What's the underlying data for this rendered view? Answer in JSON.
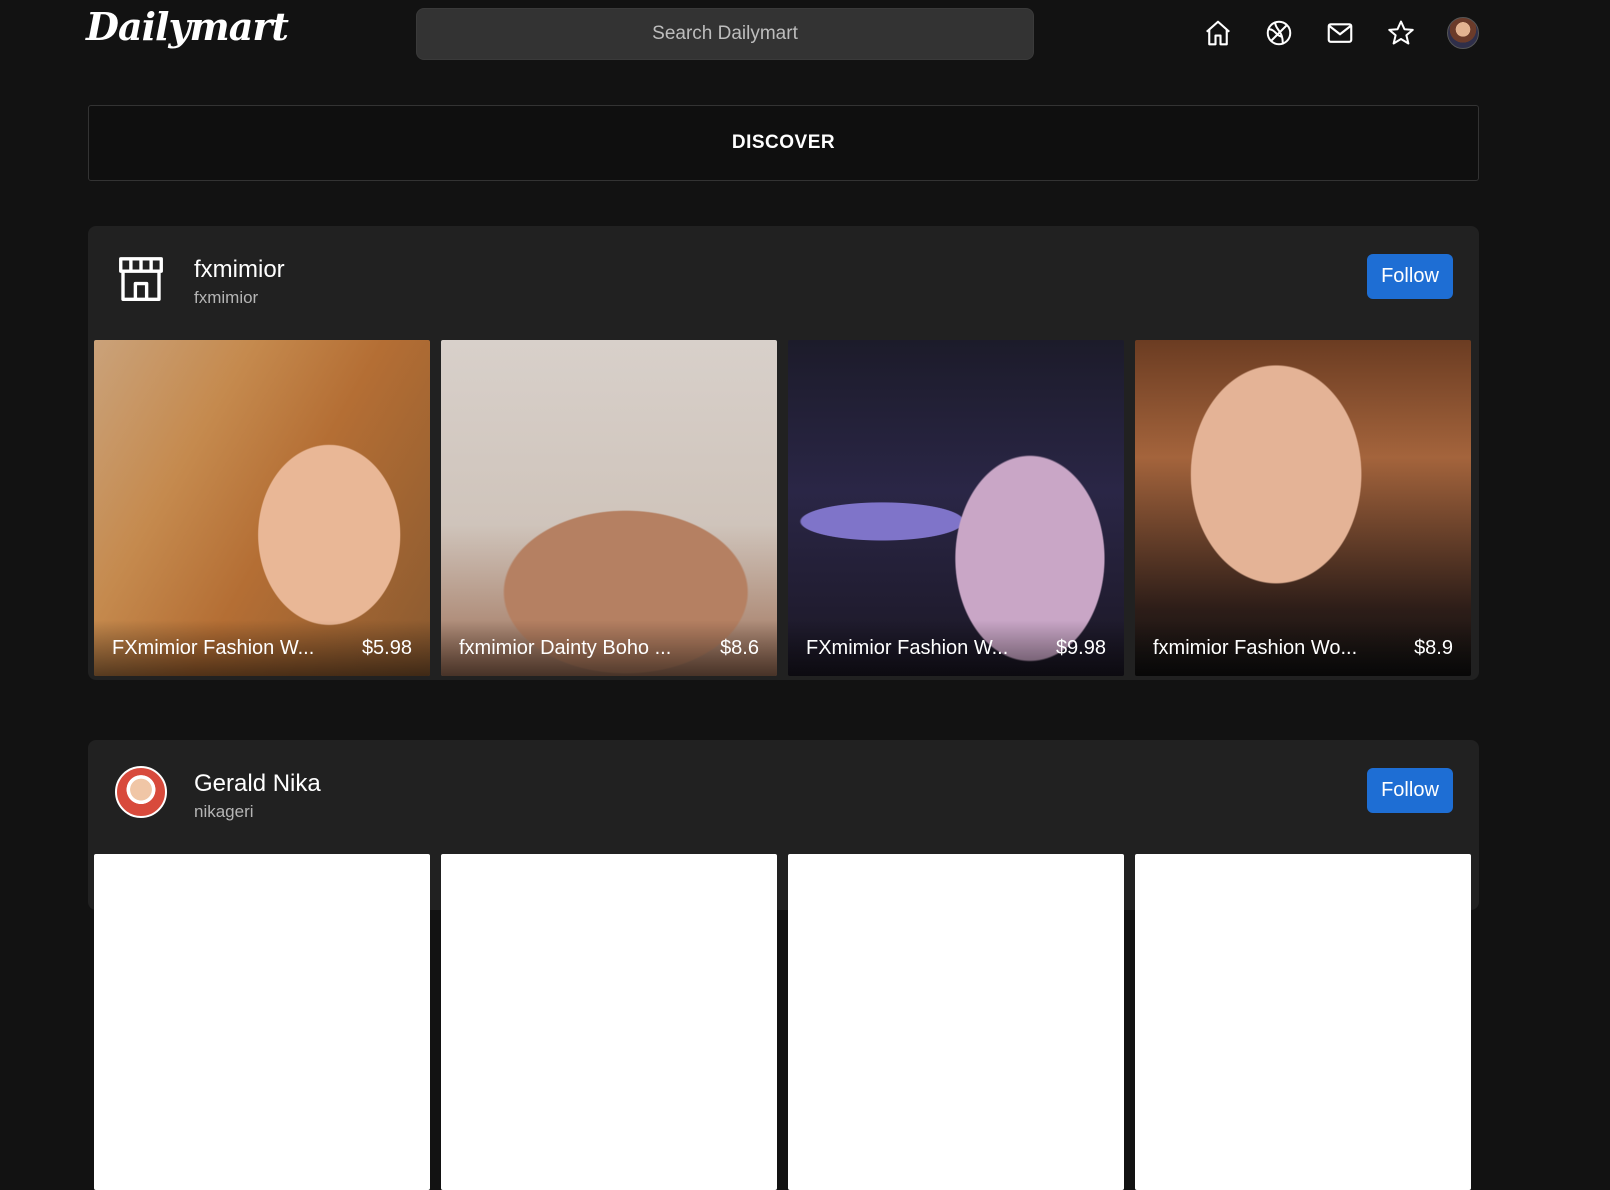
{
  "app": {
    "logo_text": "Dailymart"
  },
  "search": {
    "placeholder": "Search Dailymart"
  },
  "nav": {
    "icons": [
      "home-icon",
      "explore-icon",
      "mail-icon",
      "star-icon",
      "profile-avatar"
    ]
  },
  "discover": {
    "label": "DISCOVER"
  },
  "colors": {
    "background": "#121212",
    "card": "#212121",
    "follow_button": "#1e6ed4"
  },
  "sellers": [
    {
      "name": "fxmimior",
      "handle": "fxmimior",
      "avatar_icon": "store-icon",
      "follow_label": "Follow",
      "products": [
        {
          "title": "FXmimior Fashion W...",
          "price": "$5.98"
        },
        {
          "title": "fxmimior Dainty Boho ...",
          "price": "$8.6"
        },
        {
          "title": "FXmimior Fashion W...",
          "price": "$9.98"
        },
        {
          "title": "fxmimior Fashion Wo...",
          "price": "$8.9"
        }
      ]
    },
    {
      "name": "Gerald Nika",
      "handle": "nikageri",
      "avatar_icon": "user-avatar",
      "follow_label": "Follow"
    }
  ]
}
